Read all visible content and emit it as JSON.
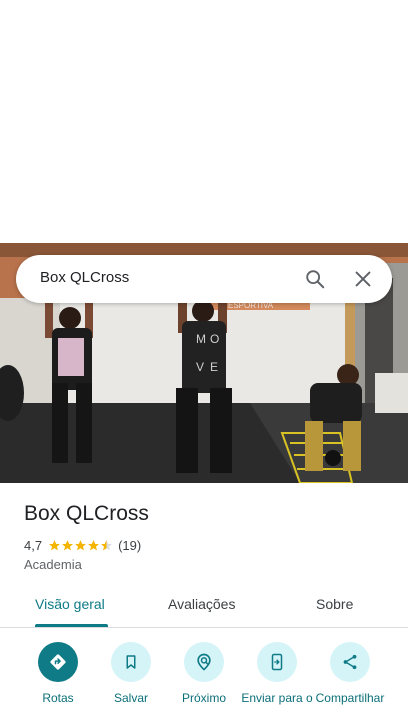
{
  "search": {
    "query": "Box QLCross"
  },
  "photo": {
    "shirt_text": [
      "M",
      "O",
      "V",
      "E"
    ],
    "sign_text": "ESPORTIVA"
  },
  "place": {
    "name": "Box QLCross",
    "rating": "4,7",
    "stars": 4.5,
    "reviews": "(19)",
    "category": "Academia"
  },
  "tabs": [
    {
      "label": "Visão geral",
      "active": true
    },
    {
      "label": "Avaliações",
      "active": false
    },
    {
      "label": "Sobre",
      "active": false
    }
  ],
  "actions": [
    {
      "label": "Rotas",
      "icon": "directions-icon"
    },
    {
      "label": "Salvar",
      "icon": "bookmark-icon"
    },
    {
      "label": "Próximo",
      "icon": "nearby-icon"
    },
    {
      "label": "Enviar para o",
      "icon": "send-to-phone-icon"
    },
    {
      "label": "Compartilhar",
      "icon": "share-icon"
    }
  ],
  "colors": {
    "accent": "#0f7b86",
    "accent_light": "#d5f4f8",
    "star": "#f4b400"
  }
}
